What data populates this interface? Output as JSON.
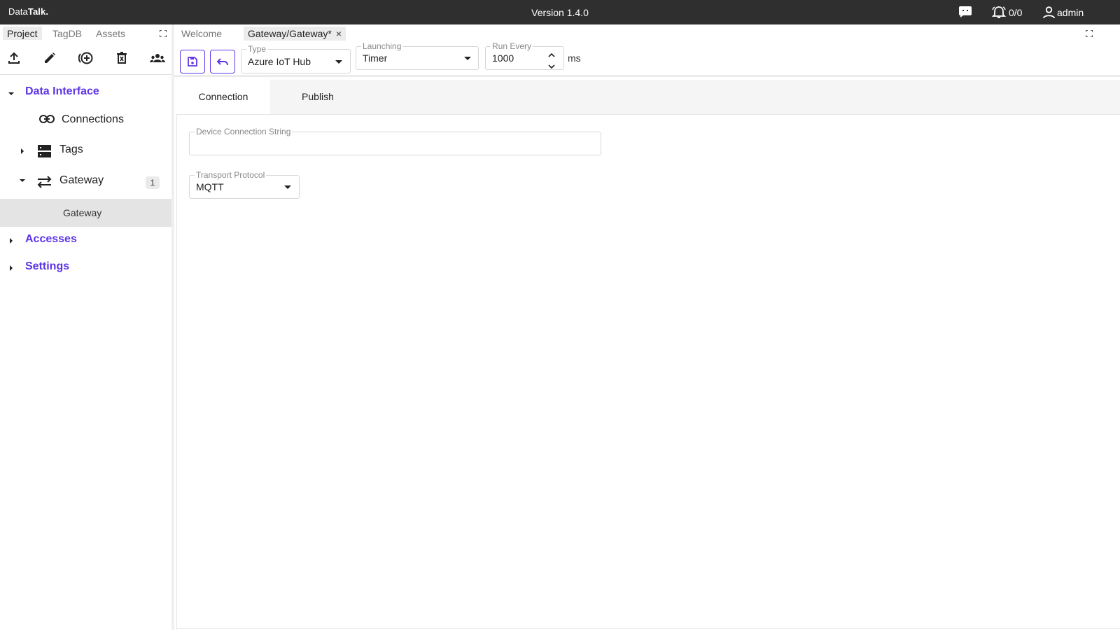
{
  "app": {
    "brand_prefix": "Data",
    "brand_bold": "Talk.",
    "version": "Version 1.4.0",
    "alarms": "0/0",
    "user": "admin"
  },
  "left_tabs": [
    {
      "label": "Project",
      "active": true
    },
    {
      "label": "TagDB",
      "active": false
    },
    {
      "label": "Assets",
      "active": false
    }
  ],
  "left_tools": [
    "upload-icon",
    "edit-icon",
    "add-circle-icon",
    "delete-icon",
    "group-icon"
  ],
  "tree": {
    "data_interface": "Data Interface",
    "connections": "Connections",
    "tags": "Tags",
    "gateway": "Gateway",
    "gateway_count": "1",
    "gateway_child": "Gateway",
    "accesses": "Accesses",
    "settings": "Settings"
  },
  "doc_tabs": [
    {
      "label": "Welcome",
      "active": false
    },
    {
      "label": "Gateway/Gateway*",
      "active": true,
      "close": "×"
    }
  ],
  "toolbar": {
    "type_label": "Type",
    "type_value": "Azure IoT Hub",
    "launching_label": "Launching",
    "launching_value": "Timer",
    "run_every_label": "Run Every",
    "run_every_value": "1000",
    "unit": "ms"
  },
  "content_tabs": [
    {
      "label": "Connection",
      "active": true
    },
    {
      "label": "Publish",
      "active": false
    }
  ],
  "form": {
    "device_connection_string_label": "Device Connection String",
    "device_connection_string_value": "",
    "transport_protocol_label": "Transport Protocol",
    "transport_protocol_value": "MQTT"
  },
  "colors": {
    "accent": "#5e35e6",
    "topbar": "#2f2f2f"
  }
}
